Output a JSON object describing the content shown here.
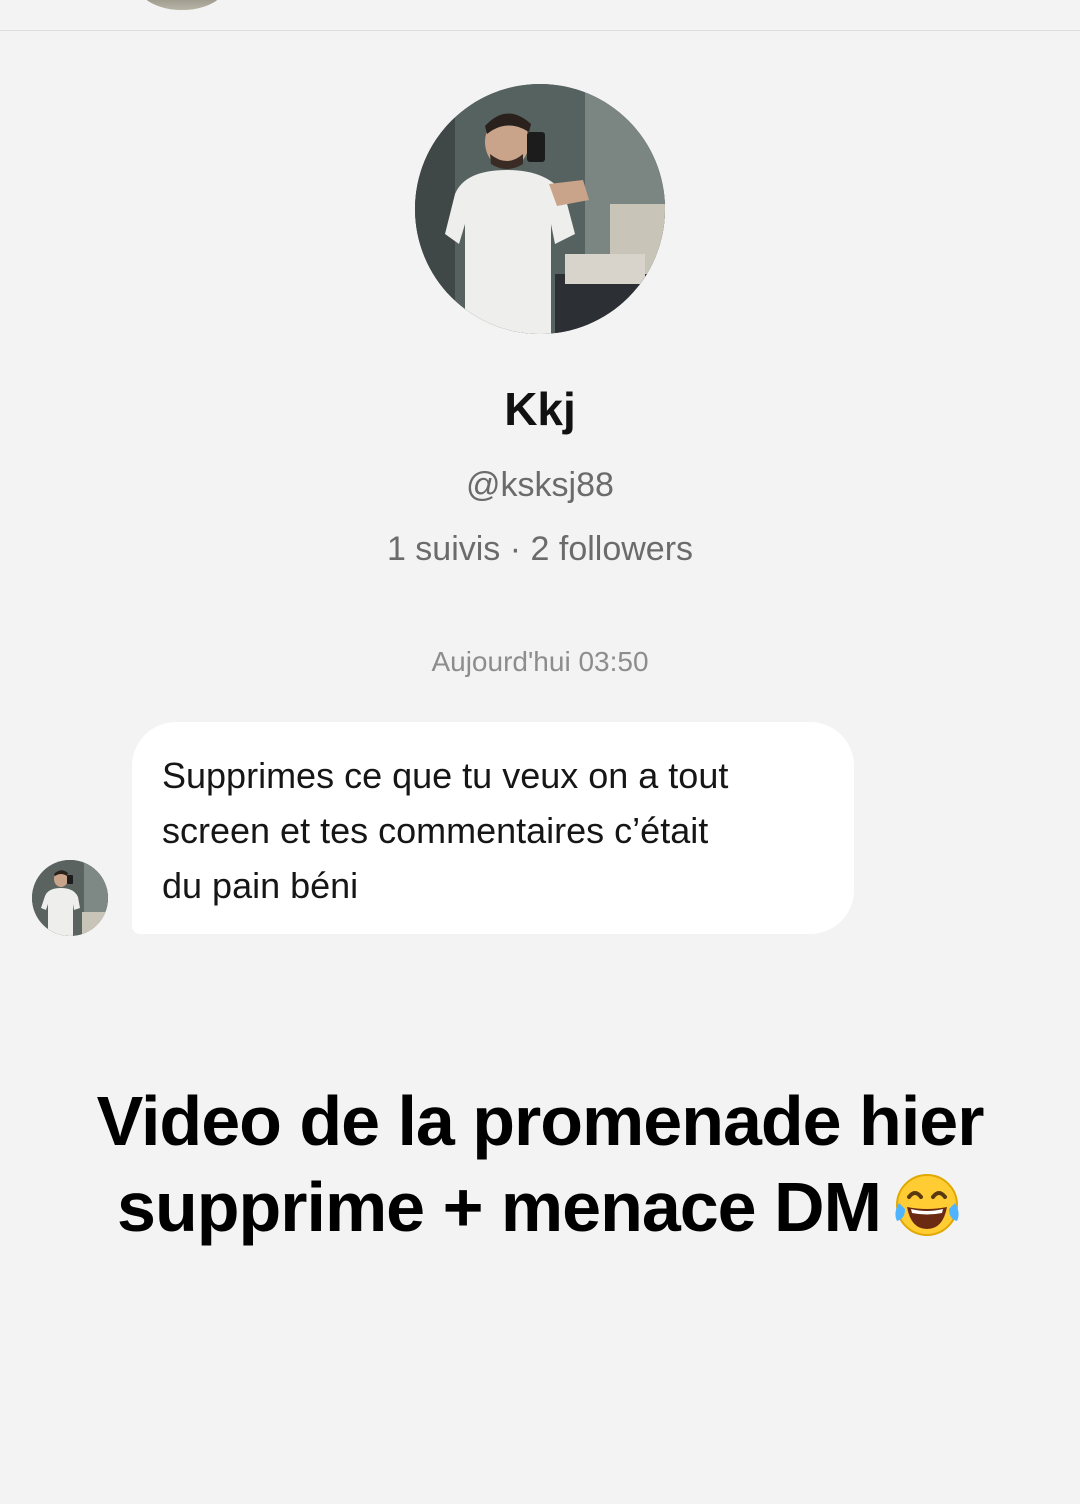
{
  "profile": {
    "name": "Kkj",
    "handle": "@ksksj88",
    "stats": "1 suivis · 2 followers"
  },
  "conversation": {
    "timestamp": "Aujourd'hui 03:50",
    "message_lines": [
      "Supprimes ce que tu veux on a tout",
      "screen et tes commentaires c’était",
      "du pain béni"
    ]
  },
  "caption": {
    "line1": "Video de la promenade hier",
    "line2": "supprime + menace DM",
    "emoji_icon": "face-with-tears-of-joy-icon"
  }
}
